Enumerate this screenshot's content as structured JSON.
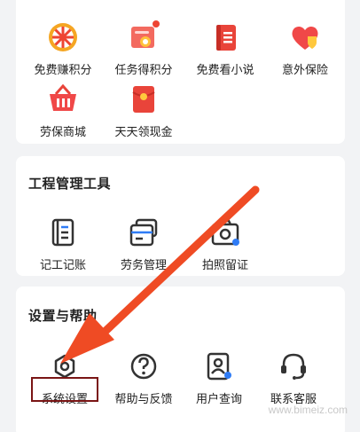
{
  "colors": {
    "accent_red": "#ee4433",
    "annotation_red": "#ef4b24",
    "highlight_border": "#7a1515",
    "icon_dark": "#333333",
    "icon_blue": "#2f7cf6"
  },
  "benefits": {
    "items": [
      {
        "label": "免费赚积分",
        "icon": "wheel-icon"
      },
      {
        "label": "任务得积分",
        "icon": "task-card-icon"
      },
      {
        "label": "免费看小说",
        "icon": "book-icon"
      },
      {
        "label": "意外保险",
        "icon": "heart-shield-icon"
      },
      {
        "label": "劳保商城",
        "icon": "shopping-basket-icon"
      },
      {
        "label": "天天领现金",
        "icon": "red-envelope-icon"
      }
    ]
  },
  "tools": {
    "title": "工程管理工具",
    "items": [
      {
        "label": "记工记账",
        "icon": "ledger-icon"
      },
      {
        "label": "劳务管理",
        "icon": "labor-cards-icon"
      },
      {
        "label": "拍照留证",
        "icon": "camera-icon"
      }
    ]
  },
  "settings": {
    "title": "设置与帮助",
    "items": [
      {
        "label": "系统设置",
        "icon": "hexagon-settings-icon"
      },
      {
        "label": "帮助与反馈",
        "icon": "question-icon"
      },
      {
        "label": "用户查询",
        "icon": "user-search-icon"
      },
      {
        "label": "联系客服",
        "icon": "headset-icon"
      }
    ]
  },
  "watermark": "www.bimeiz.com"
}
